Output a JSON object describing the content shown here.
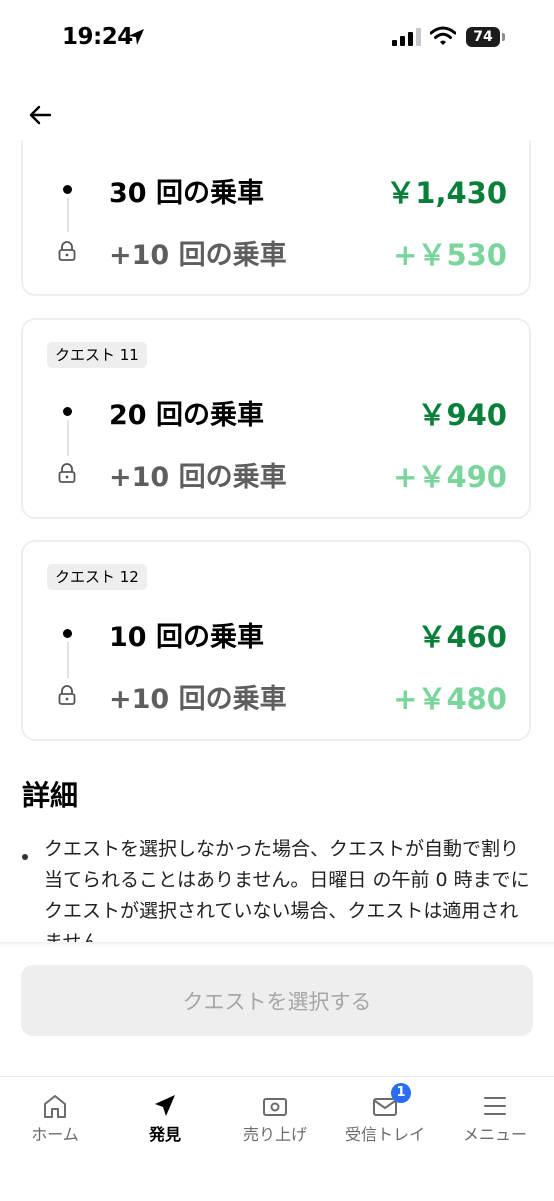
{
  "status_bar": {
    "time": "19:24",
    "battery": "74"
  },
  "quests": [
    {
      "badge": "",
      "rows": [
        {
          "label": "30 回の乗車",
          "value": "￥1,430"
        },
        {
          "label": "+10 回の乗車",
          "value": "+￥530"
        }
      ]
    },
    {
      "badge": "クエスト 11",
      "rows": [
        {
          "label": "20 回の乗車",
          "value": "￥940"
        },
        {
          "label": "+10 回の乗車",
          "value": "+￥490"
        }
      ]
    },
    {
      "badge": "クエスト 12",
      "rows": [
        {
          "label": "10 回の乗車",
          "value": "￥460"
        },
        {
          "label": "+10 回の乗車",
          "value": "+￥480"
        }
      ]
    }
  ],
  "details": {
    "heading": "詳細",
    "text": "クエストを選択しなかった場合、クエストが自動で割り当てられることはありません。日曜日 の午前 0 時までにクエストが選択されていない場合、クエストは適用されません。"
  },
  "select_button": {
    "label": "クエストを選択する"
  },
  "tabs": [
    {
      "label": "ホーム",
      "icon": "home-icon"
    },
    {
      "label": "発見",
      "icon": "compass-icon",
      "active": true
    },
    {
      "label": "売り上げ",
      "icon": "wallet-icon"
    },
    {
      "label": "受信トレイ",
      "icon": "mail-icon",
      "badge": "1"
    },
    {
      "label": "メニュー",
      "icon": "menu-icon"
    }
  ],
  "colors": {
    "value_green": "#0a7f3a",
    "value_green_light": "#79d59b",
    "badge_blue": "#276ef1",
    "button_disabled_bg": "#eeeeee"
  }
}
